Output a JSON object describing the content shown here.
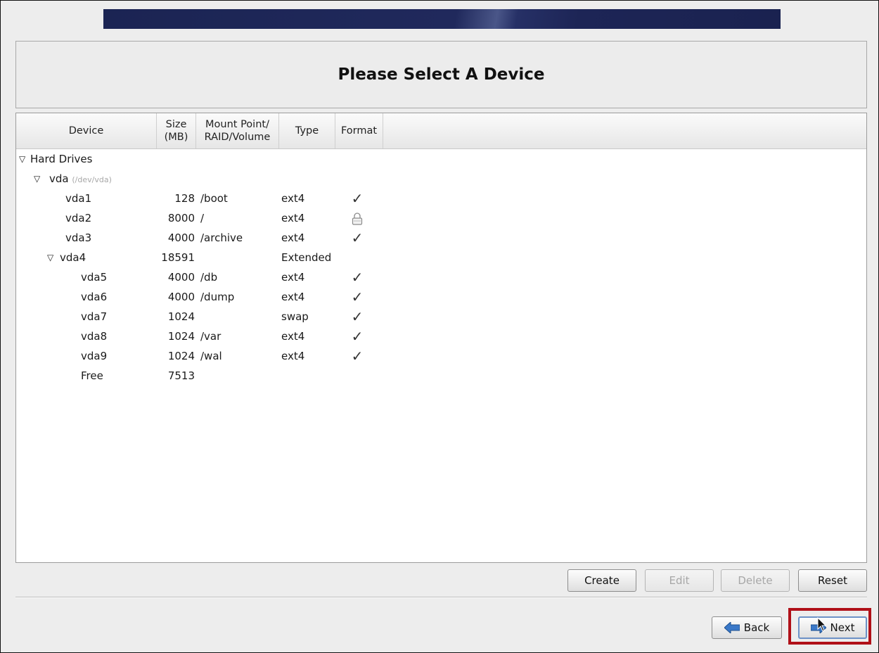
{
  "header": {
    "title": "Please Select A Device"
  },
  "columns": {
    "device": "Device",
    "size_line1": "Size",
    "size_line2": "(MB)",
    "mount_line1": "Mount Point/",
    "mount_line2": "RAID/Volume",
    "type": "Type",
    "format": "Format"
  },
  "tree": {
    "group": "Hard Drives",
    "disk": {
      "name": "vda",
      "path": "(/dev/vda)"
    },
    "rows": [
      {
        "device": "vda1",
        "size": "128",
        "mount": "/boot",
        "type": "ext4",
        "format_icon": "check-icon"
      },
      {
        "device": "vda2",
        "size": "8000",
        "mount": "/",
        "type": "ext4",
        "format_icon": "lock-icon"
      },
      {
        "device": "vda3",
        "size": "4000",
        "mount": "/archive",
        "type": "ext4",
        "format_icon": "check-icon"
      },
      {
        "device": "vda4",
        "size": "18591",
        "mount": "",
        "type": "Extended",
        "format_icon": ""
      },
      {
        "device": "vda5",
        "size": "4000",
        "mount": "/db",
        "type": "ext4",
        "format_icon": "check-icon"
      },
      {
        "device": "vda6",
        "size": "4000",
        "mount": "/dump",
        "type": "ext4",
        "format_icon": "check-icon"
      },
      {
        "device": "vda7",
        "size": "1024",
        "mount": "",
        "type": "swap",
        "format_icon": "check-icon"
      },
      {
        "device": "vda8",
        "size": "1024",
        "mount": "/var",
        "type": "ext4",
        "format_icon": "check-icon"
      },
      {
        "device": "vda9",
        "size": "1024",
        "mount": "/wal",
        "type": "ext4",
        "format_icon": "check-icon"
      },
      {
        "device": "Free",
        "size": "7513",
        "mount": "",
        "type": "",
        "format_icon": ""
      }
    ]
  },
  "actions": {
    "create": "Create",
    "edit": "Edit",
    "delete": "Delete",
    "reset": "Reset"
  },
  "nav": {
    "back": "Back",
    "next": "Next"
  },
  "colors": {
    "highlight": "#b01018",
    "banner": "#1b2453",
    "arrow": "#3a78c8"
  }
}
